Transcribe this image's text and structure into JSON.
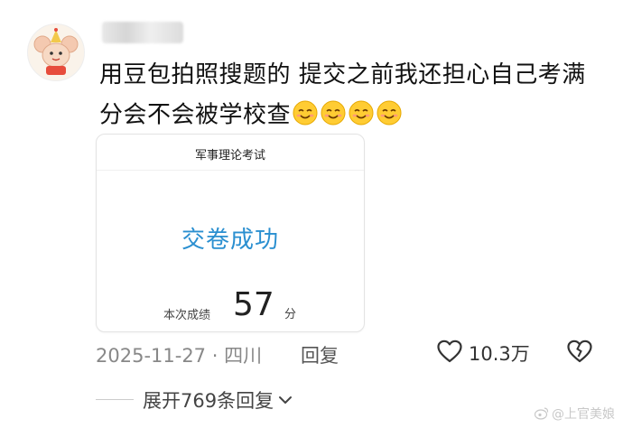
{
  "comment": {
    "text": "用豆包拍照搜题的 提交之前我还担心自己考满分会不会被学校查",
    "emoji": [
      "smiling-face-icon",
      "smiling-face-icon",
      "smiling-face-icon",
      "smiling-face-icon"
    ]
  },
  "card": {
    "title": "军事理论考试",
    "status": "交卷成功",
    "score_label": "本次成绩",
    "score_value": "57",
    "score_unit": "分",
    "status_color": "#2a8fd0"
  },
  "meta": {
    "date_location": "2025-11-27 · 四川",
    "reply_label": "回复",
    "like_count": "10.3万"
  },
  "replies": {
    "expand_label": "展开769条回复"
  },
  "watermark": {
    "text": "@上官美娘"
  }
}
